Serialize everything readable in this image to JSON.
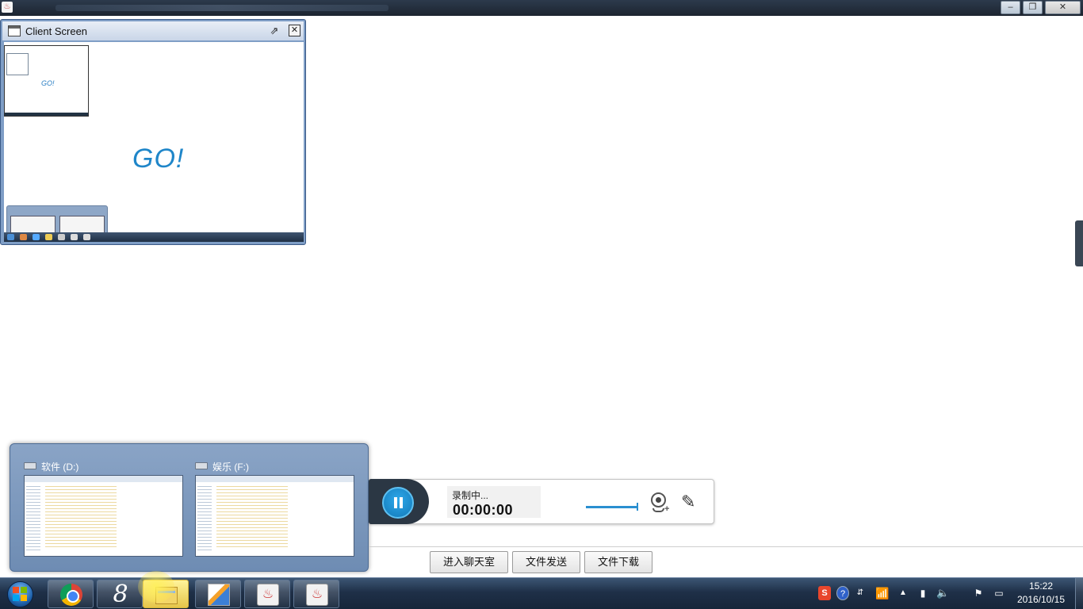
{
  "window": {
    "app_icon": "java-icon",
    "minimize_icon": "minimize-icon",
    "maximize_icon": "restore-icon",
    "close_icon": "close-icon",
    "minimize_glyph": "–",
    "maximize_glyph": "❐",
    "close_glyph": "✕"
  },
  "client_screen": {
    "title": "Client Screen",
    "popout_glyph": "⇗",
    "close_glyph": "✕",
    "content_text": "GO!"
  },
  "drive_popup": {
    "drives": [
      {
        "label": "软件 (D:)"
      },
      {
        "label": "娱乐 (F:)"
      }
    ]
  },
  "recorder": {
    "status": "录制中...",
    "time": "00:00:00",
    "volume_level": 1.0,
    "pen_glyph": "✎",
    "plus_glyph": "+"
  },
  "buttons": {
    "chat": "进入聊天室",
    "send_file": "文件发送",
    "download_file": "文件下载"
  },
  "taskbar": {
    "apps": [
      "chrome-icon",
      "s8-icon",
      "explorer-icon",
      "paint-icon",
      "java-icon",
      "java-icon"
    ],
    "s8_glyph": "8",
    "java_glyph": "♨"
  },
  "tray": {
    "sogou": "S",
    "help": "?",
    "ime": "⇵",
    "wifi": "📶",
    "up": "▲",
    "device": "▮",
    "volume": "🔈",
    "flag": "⚑",
    "display": "▭",
    "time": "15:22",
    "date": "2016/10/15"
  },
  "colors": {
    "accent_blue": "#1f86c9",
    "taskbar": "#1f3048",
    "popup": "#7f9ec6",
    "recorder_dark": "#2b3744"
  }
}
